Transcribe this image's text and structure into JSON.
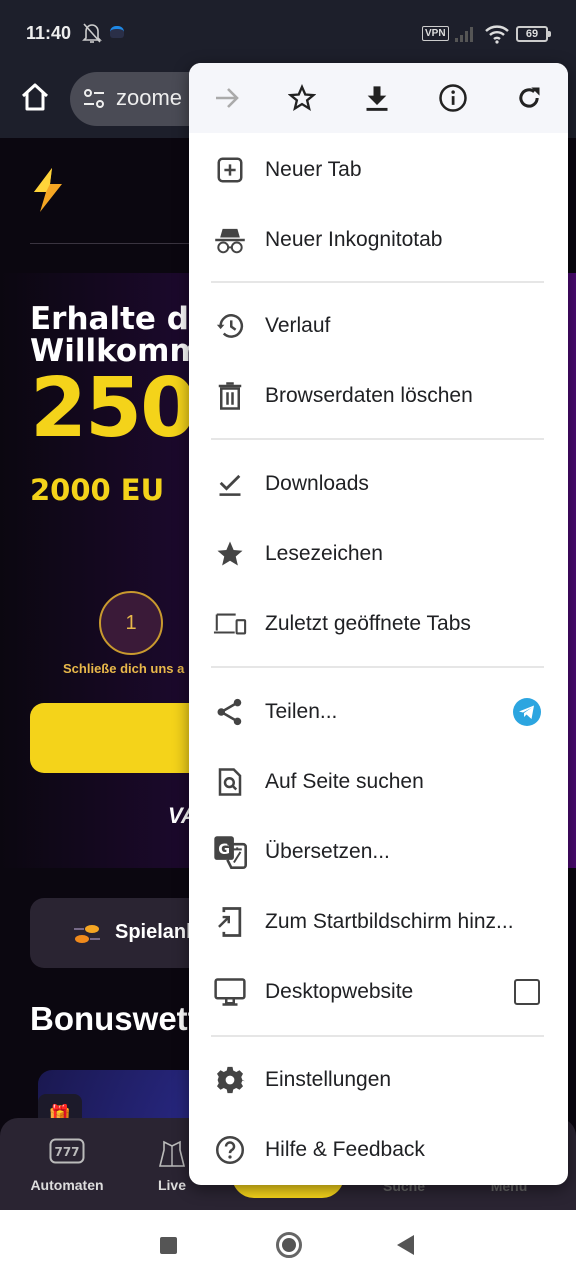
{
  "status_bar": {
    "time": "11:40",
    "vpn_label": "VPN",
    "battery_level": "69",
    "icons": [
      "bell-off-icon",
      "app-notification-icon",
      "vpn-icon",
      "signal-icon",
      "wifi-icon",
      "battery-icon"
    ]
  },
  "browser": {
    "url_text": "zoome",
    "home_icon": "home-icon",
    "site_info_icon": "tune-icon"
  },
  "web": {
    "hero": {
      "title_line1": "Erhalte d",
      "title_line2": "Willkomm",
      "amount": "250",
      "subline": "2000 EU",
      "step_number": "1",
      "step_label": "Schließe dich uns a",
      "brand_fragment": "VA"
    },
    "provider_button_label": "Spielanb",
    "section_title": "Bonuswett",
    "bottom_nav": [
      {
        "label": "Automaten",
        "icon": "slot-777-icon"
      },
      {
        "label": "Live",
        "icon": "dealer-icon"
      },
      {
        "label": "",
        "icon": "center-action"
      },
      {
        "label": "Suche",
        "icon": "search-icon"
      },
      {
        "label": "Menü",
        "icon": "menu-icon"
      }
    ],
    "slot_icon_text": "777"
  },
  "menu": {
    "top_actions": [
      {
        "name": "forward",
        "icon": "forward-arrow-icon",
        "enabled": false
      },
      {
        "name": "bookmark",
        "icon": "star-outline-icon",
        "enabled": true
      },
      {
        "name": "download",
        "icon": "download-icon",
        "enabled": true
      },
      {
        "name": "page-info",
        "icon": "info-icon",
        "enabled": true
      },
      {
        "name": "reload",
        "icon": "reload-icon",
        "enabled": true
      }
    ],
    "items": [
      {
        "label": "Neuer Tab",
        "icon": "new-tab-icon"
      },
      {
        "label": "Neuer Inkognitotab",
        "icon": "incognito-icon"
      },
      {
        "label": "Verlauf",
        "icon": "history-icon"
      },
      {
        "label": "Browserdaten löschen",
        "icon": "trash-icon"
      },
      {
        "label": "Downloads",
        "icon": "downloads-done-icon"
      },
      {
        "label": "Lesezeichen",
        "icon": "star-filled-icon"
      },
      {
        "label": "Zuletzt geöffnete Tabs",
        "icon": "devices-icon"
      },
      {
        "label": "Teilen...",
        "icon": "share-icon",
        "trailing": "telegram-icon"
      },
      {
        "label": "Auf Seite suchen",
        "icon": "find-in-page-icon"
      },
      {
        "label": "Übersetzen...",
        "icon": "translate-icon"
      },
      {
        "label": "Zum Startbildschirm hinz...",
        "icon": "add-to-home-icon"
      },
      {
        "label": "Desktopwebsite",
        "icon": "desktop-icon",
        "checked": false
      },
      {
        "label": "Einstellungen",
        "icon": "settings-icon"
      },
      {
        "label": "Hilfe & Feedback",
        "icon": "help-icon"
      }
    ]
  },
  "colors": {
    "accent_yellow": "#f4d31a",
    "telegram_blue": "#2ca5e0",
    "menu_icon_gray": "#444444"
  }
}
